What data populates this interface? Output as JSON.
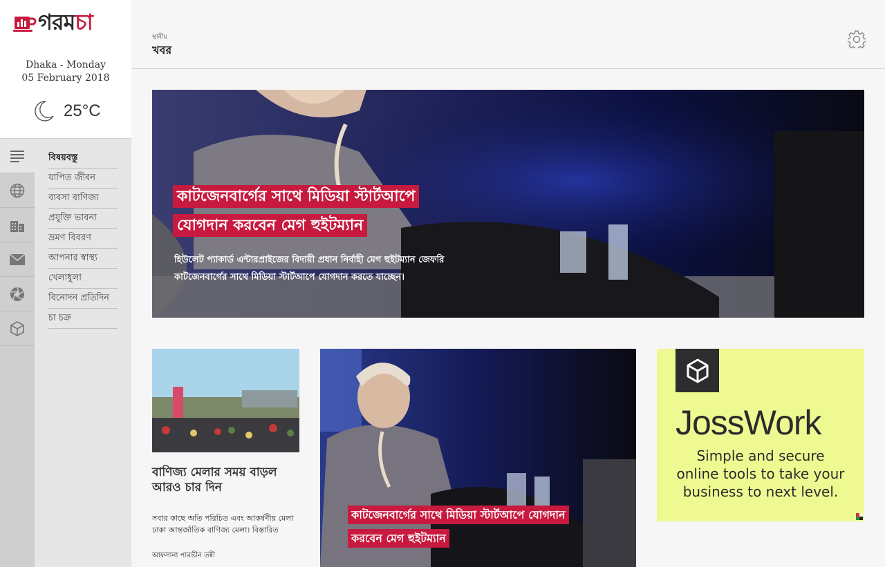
{
  "brand": {
    "logo_text_dark": "গরম",
    "logo_text_red": "চা",
    "accent_color": "#c8193e"
  },
  "location": {
    "date_line1": "Dhaka - Monday",
    "date_line2": "05 February 2018"
  },
  "weather": {
    "icon": "moon-icon",
    "temperature": "25°C"
  },
  "rail_icons": [
    "menu-lines-icon",
    "globe-icon",
    "building-icon",
    "mail-icon",
    "camera-aperture-icon",
    "cube-icon"
  ],
  "menu": {
    "heading": "বিষয়বস্তু",
    "items": [
      "যাপিত জীবন",
      "ব্যবসা বাণিজ্য",
      "প্রযুক্তি ভাবনা",
      "ভ্রমণ বিবরণ",
      "আপনার স্বাস্থ্য",
      "খেলাধুলা",
      "বিনোদন প্রতিদিন",
      "চা চক্র"
    ]
  },
  "header": {
    "subtitle": "স্থানীয়",
    "title": "খবর",
    "settings_icon": "gear-icon"
  },
  "hero": {
    "title_line1": "কাটজেনবার্গের সাথে মিডিয়া স্টার্টআপে",
    "title_line2": "যোগদান করবেন মেগ হুইটম্যান",
    "description_line1": "হিউলেট প্যাকার্ড এন্টারপ্রাইজের বিদায়ী প্রধান নির্বাহী মেগ হুইটম্যান জেফরি",
    "description_line2": "কাটজেনবার্গের সাথে মিডিয়া স্টার্টআপে যোগদান করতে যাচ্ছেন।"
  },
  "card1": {
    "title": "বাণিজ্য মেলার সময় বাড়ল আরও চার দিন",
    "description": "সবার কাছে অতি পরিচিত এবং আকর্ষণীয় মেলা ঢাকা আন্তর্জাতিক বাণিজ্য মেলা। বিস্তারিত",
    "author": "আফসানা পারভীন তন্বী"
  },
  "card2": {
    "title_line1": "কাটজেনবার্গের সাথে মিডিয়া স্টার্টআপে যোগদান",
    "title_line2": "করবেন মেগ হুইটম্যান"
  },
  "ad": {
    "brand": "JossWork",
    "tagline_line1": "Simple and secure",
    "tagline_line2": "online tools to take your",
    "tagline_line3": "business to next level.",
    "logo_icon": "cube-icon",
    "background_color": "#eefa91"
  }
}
